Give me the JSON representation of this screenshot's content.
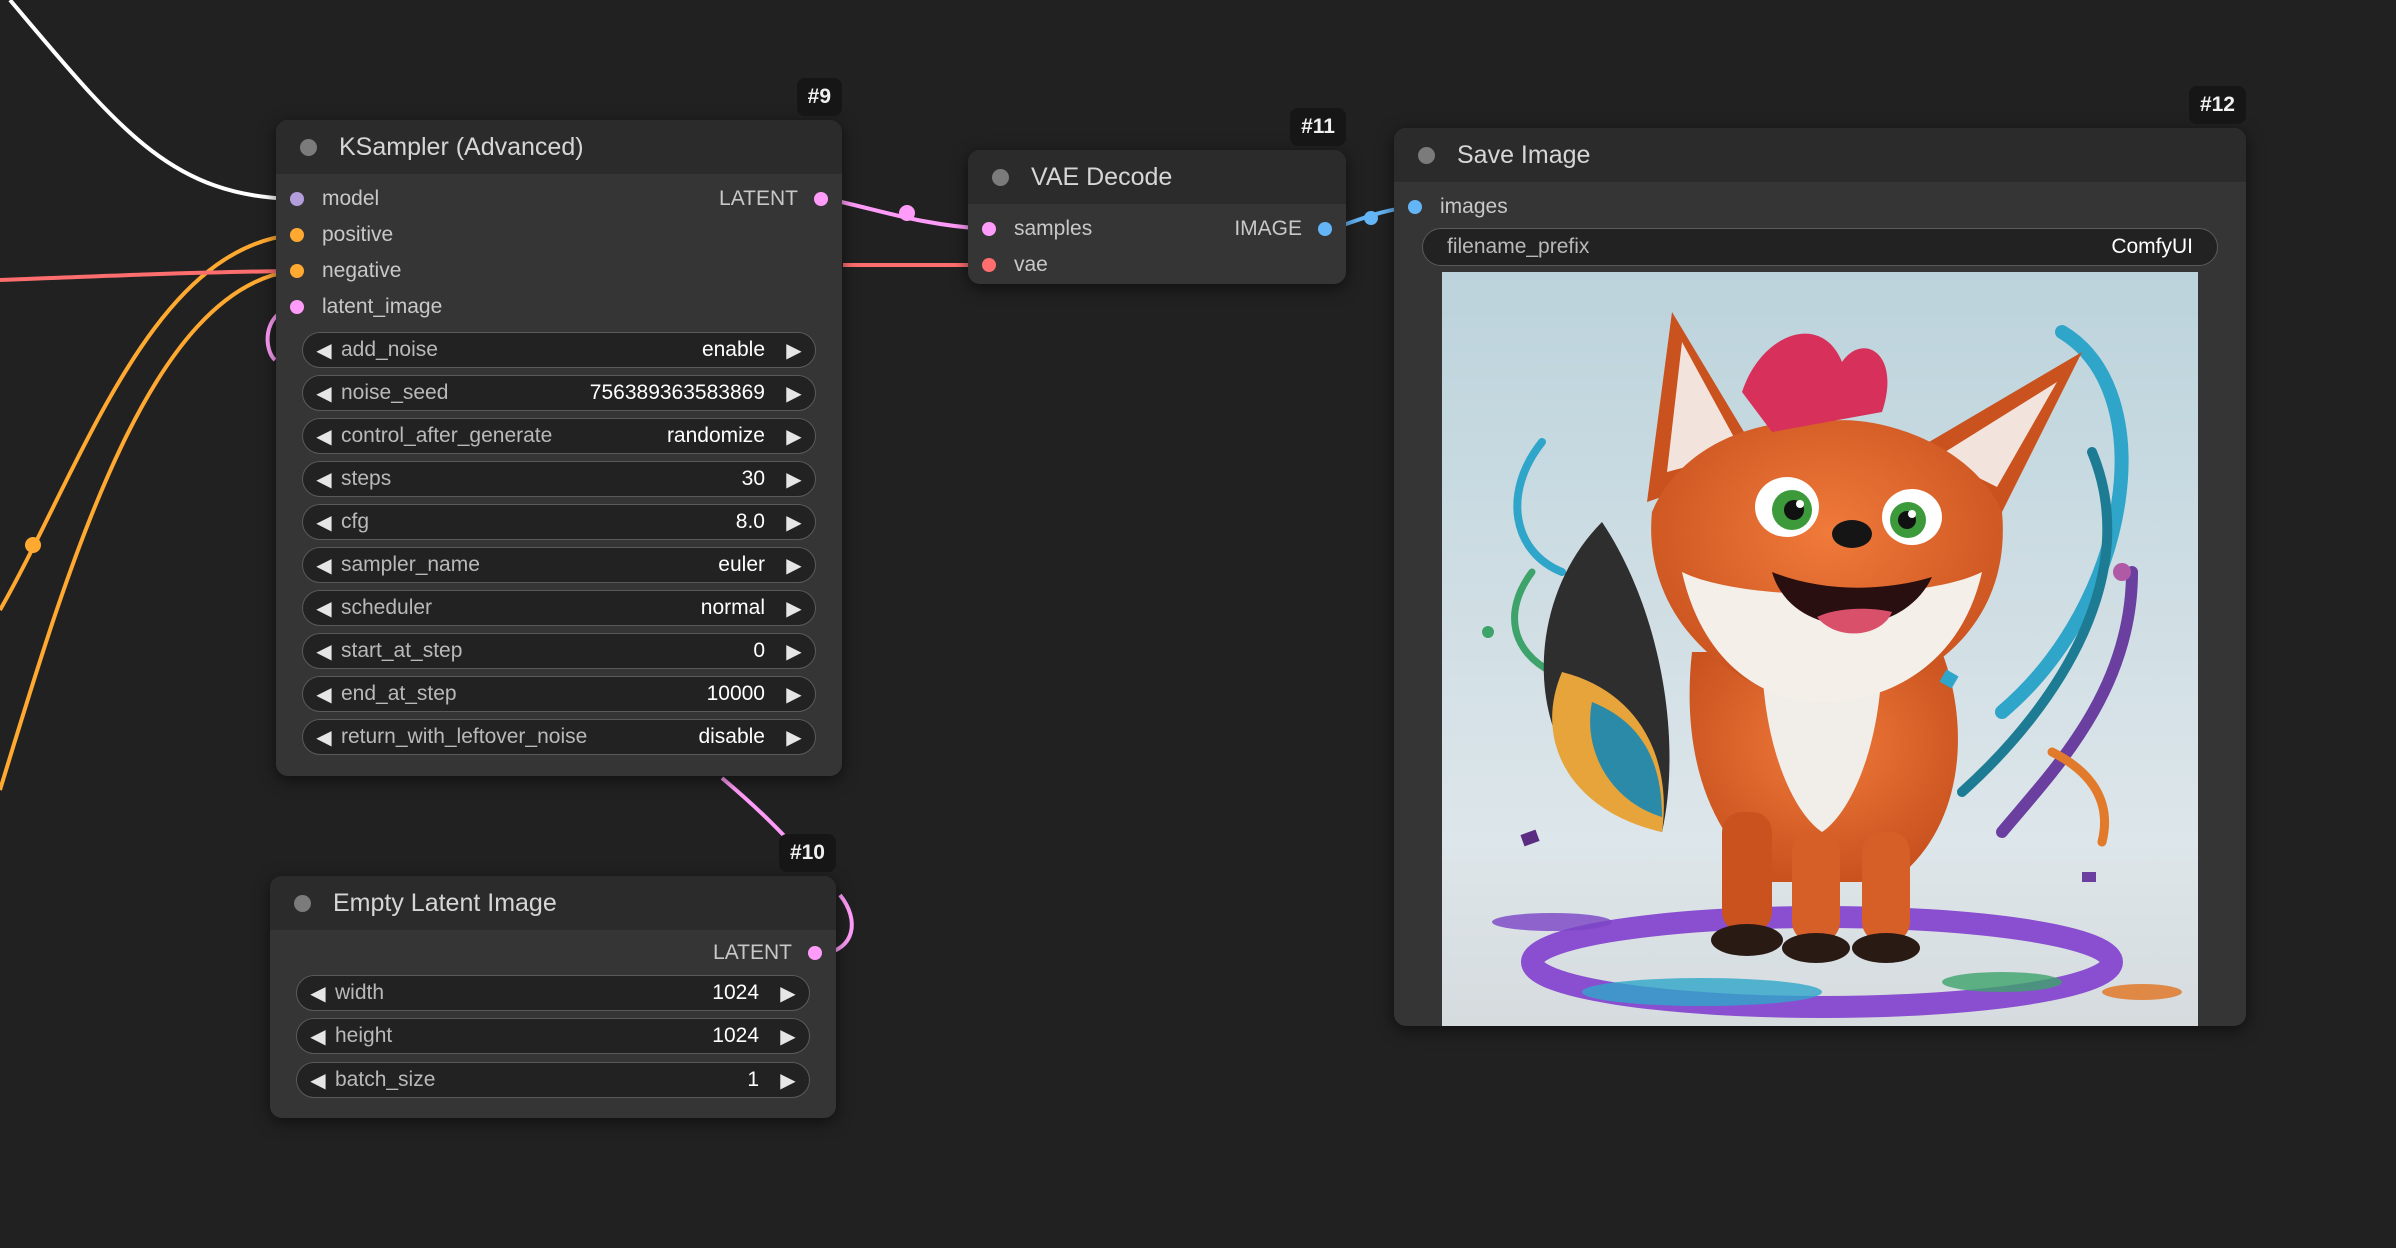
{
  "colors": {
    "canvas": "#212121",
    "node_body": "#353535",
    "node_header": "#2b2b2b",
    "wire_model": "#ffffff",
    "wire_conditioning": "#ffa931",
    "wire_latent": "#ff9cf9",
    "wire_vae": "#ff6e6e",
    "wire_image": "#64b5f6"
  },
  "nodes": {
    "ksampler": {
      "id": "#9",
      "title": "KSampler (Advanced)",
      "inputs": [
        {
          "label": "model",
          "type_color": "#b39ddb"
        },
        {
          "label": "positive",
          "type_color": "#ffa931"
        },
        {
          "label": "negative",
          "type_color": "#ffa931"
        },
        {
          "label": "latent_image",
          "type_color": "#ff9cf9"
        }
      ],
      "output": {
        "label": "LATENT",
        "type_color": "#ff9cf9"
      },
      "widgets": [
        {
          "label": "add_noise",
          "value": "enable"
        },
        {
          "label": "noise_seed",
          "value": "756389363583869"
        },
        {
          "label": "control_after_generate",
          "value": "randomize"
        },
        {
          "label": "steps",
          "value": "30"
        },
        {
          "label": "cfg",
          "value": "8.0"
        },
        {
          "label": "sampler_name",
          "value": "euler"
        },
        {
          "label": "scheduler",
          "value": "normal"
        },
        {
          "label": "start_at_step",
          "value": "0"
        },
        {
          "label": "end_at_step",
          "value": "10000"
        },
        {
          "label": "return_with_leftover_noise",
          "value": "disable"
        }
      ]
    },
    "vae_decode": {
      "id": "#11",
      "title": "VAE Decode",
      "inputs": [
        {
          "label": "samples",
          "type_color": "#ff9cf9"
        },
        {
          "label": "vae",
          "type_color": "#ff6e6e"
        }
      ],
      "output": {
        "label": "IMAGE",
        "type_color": "#64b5f6"
      }
    },
    "save_image": {
      "id": "#12",
      "title": "Save Image",
      "inputs": [
        {
          "label": "images",
          "type_color": "#64b5f6"
        }
      ],
      "filename_prefix": {
        "label": "filename_prefix",
        "value": "ComfyUI"
      },
      "preview_icon": "cartoon-fox-image"
    },
    "empty_latent": {
      "id": "#10",
      "title": "Empty Latent Image",
      "output": {
        "label": "LATENT",
        "type_color": "#ff9cf9"
      },
      "widgets": [
        {
          "label": "width",
          "value": "1024"
        },
        {
          "label": "height",
          "value": "1024"
        },
        {
          "label": "batch_size",
          "value": "1"
        }
      ]
    }
  }
}
